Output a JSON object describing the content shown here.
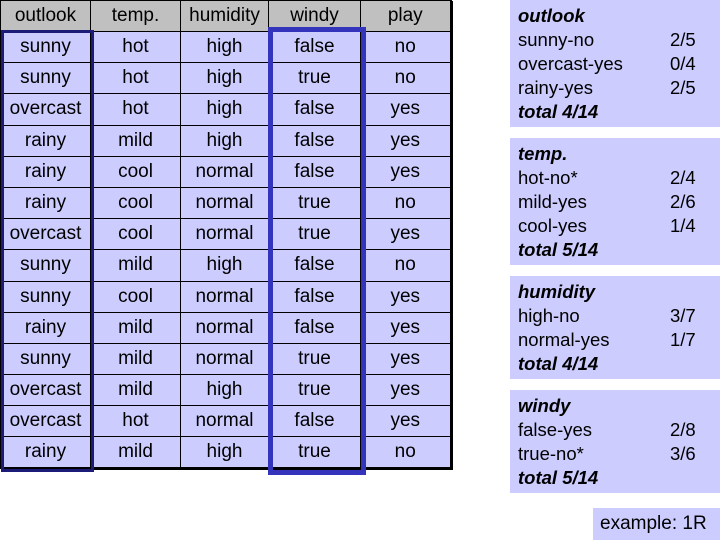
{
  "table": {
    "headers": [
      "outlook",
      "temp.",
      "humidity",
      "windy",
      "play"
    ],
    "rows": [
      [
        "sunny",
        "hot",
        "high",
        "false",
        "no"
      ],
      [
        "sunny",
        "hot",
        "high",
        "true",
        "no"
      ],
      [
        "overcast",
        "hot",
        "high",
        "false",
        "yes"
      ],
      [
        "rainy",
        "mild",
        "high",
        "false",
        "yes"
      ],
      [
        "rainy",
        "cool",
        "normal",
        "false",
        "yes"
      ],
      [
        "rainy",
        "cool",
        "normal",
        "true",
        "no"
      ],
      [
        "overcast",
        "cool",
        "normal",
        "true",
        "yes"
      ],
      [
        "sunny",
        "mild",
        "high",
        "false",
        "no"
      ],
      [
        "sunny",
        "cool",
        "normal",
        "false",
        "yes"
      ],
      [
        "rainy",
        "mild",
        "normal",
        "false",
        "yes"
      ],
      [
        "sunny",
        "mild",
        "normal",
        "true",
        "yes"
      ],
      [
        "overcast",
        "mild",
        "high",
        "true",
        "yes"
      ],
      [
        "overcast",
        "hot",
        "normal",
        "false",
        "yes"
      ],
      [
        "rainy",
        "mild",
        "high",
        "true",
        "no"
      ]
    ],
    "highlighted_columns": [
      "outlook",
      "windy"
    ],
    "colors": {
      "header_bg": "#c0c0c0",
      "cell_bg": "#ccccff",
      "outlook_highlight": "#1c1c78",
      "windy_highlight": "#3333bb"
    }
  },
  "panels": [
    {
      "id": "outlook",
      "title": "outlook",
      "rules": [
        {
          "label": "sunny-no",
          "value": "2/5"
        },
        {
          "label": "overcast-yes",
          "value": "0/4"
        },
        {
          "label": "rainy-yes",
          "value": "2/5"
        }
      ],
      "total": "total 4/14"
    },
    {
      "id": "temp",
      "title": "temp.",
      "rules": [
        {
          "label": "hot-no*",
          "value": "2/4"
        },
        {
          "label": "mild-yes",
          "value": "2/6"
        },
        {
          "label": "cool-yes",
          "value": "1/4"
        }
      ],
      "total": "total 5/14"
    },
    {
      "id": "humidity",
      "title": "humidity",
      "rules": [
        {
          "label": "high-no",
          "value": "3/7"
        },
        {
          "label": "normal-yes",
          "value": "1/7"
        }
      ],
      "total": "total 4/14"
    },
    {
      "id": "windy",
      "title": "windy",
      "rules": [
        {
          "label": "false-yes",
          "value": "2/8"
        },
        {
          "label": "true-no*",
          "value": "3/6"
        }
      ],
      "total": "total 5/14"
    }
  ],
  "example_label": "example: 1R",
  "panel_bg": "#ccccff"
}
